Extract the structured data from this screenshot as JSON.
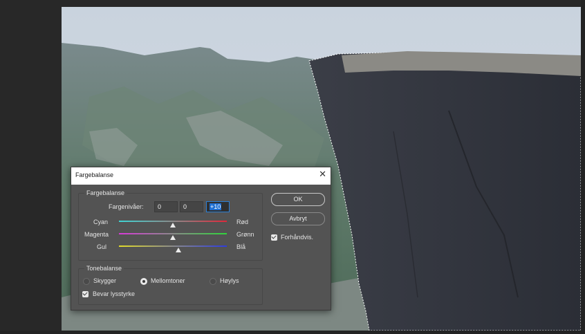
{
  "dialog": {
    "title": "Fargebalanse",
    "close_glyph": "✕",
    "color_balance_group": {
      "legend": "Fargebalanse",
      "levels_label": "Fargenivåer:",
      "levels": [
        "0",
        "0",
        "+10"
      ],
      "sliders": [
        {
          "left": "Cyan",
          "right": "Rød",
          "value": 0
        },
        {
          "left": "Magenta",
          "right": "Grønn",
          "value": 0
        },
        {
          "left": "Gul",
          "right": "Blå",
          "value": 10
        }
      ]
    },
    "tone_balance_group": {
      "legend": "Tonebalanse",
      "options": [
        "Skygger",
        "Mellomtoner",
        "Høylys"
      ],
      "selected": "Mellomtoner",
      "preserve_luminosity_label": "Bevar lysstyrke",
      "preserve_luminosity_checked": true
    },
    "ok_label": "OK",
    "cancel_label": "Avbryt",
    "preview_label": "Forhåndvis.",
    "preview_checked": true
  },
  "colors": {
    "accent": "#1f6fd1",
    "dialog_bg": "#535353",
    "workspace_bg": "#282828"
  },
  "icons": {
    "close": "close-icon",
    "checkbox": "checkbox-checked-icon",
    "slider_thumb": "triangle-up-icon"
  }
}
